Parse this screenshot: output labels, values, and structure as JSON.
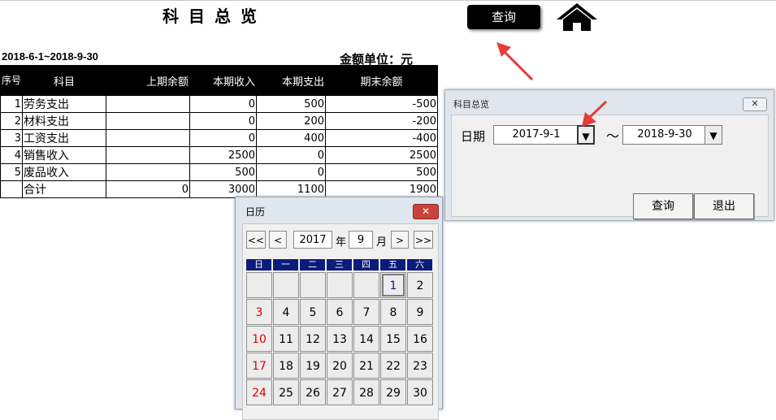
{
  "header": {
    "title": "科目总览",
    "query_label": "查询",
    "date_range": "2018-6-1~2018-9-30",
    "unit_label": "金额单位：元"
  },
  "table": {
    "columns": [
      "序号",
      "科目",
      "上期余额",
      "本期收入",
      "本期支出",
      "期末余额"
    ],
    "rows": [
      {
        "no": "1",
        "subject": "劳务支出",
        "prev": "",
        "income": "0",
        "expense": "500",
        "end": "-500"
      },
      {
        "no": "2",
        "subject": "材料支出",
        "prev": "",
        "income": "0",
        "expense": "200",
        "end": "-200"
      },
      {
        "no": "3",
        "subject": "工资支出",
        "prev": "",
        "income": "0",
        "expense": "400",
        "end": "-400"
      },
      {
        "no": "4",
        "subject": "销售收入",
        "prev": "",
        "income": "2500",
        "expense": "0",
        "end": "2500"
      },
      {
        "no": "5",
        "subject": "废品收入",
        "prev": "",
        "income": "500",
        "expense": "0",
        "end": "500"
      }
    ],
    "total": {
      "no": "",
      "subject": "合计",
      "prev": "0",
      "income": "3000",
      "expense": "1100",
      "end": "1900"
    }
  },
  "dialog": {
    "title": "科目总览",
    "close": "✕",
    "date_label": "日期",
    "start_date": "2017-9-1",
    "end_date": "2018-9-30",
    "dropdown": "▼",
    "tilde": "～",
    "query_label": "查询",
    "exit_label": "退出"
  },
  "calendar": {
    "title": "日历",
    "close": "✕",
    "prev_year": "<<",
    "prev_month": "<",
    "next_month": ">",
    "next_year": ">>",
    "year": "2017",
    "year_label": "年",
    "month": "9",
    "month_label": "月",
    "weekdays": [
      "日",
      "一",
      "二",
      "三",
      "四",
      "五",
      "六"
    ],
    "selected_day": "1",
    "days": [
      "",
      "",
      "",
      "",
      "",
      "1",
      "2",
      "3",
      "4",
      "5",
      "6",
      "7",
      "8",
      "9",
      "10",
      "11",
      "12",
      "13",
      "14",
      "15",
      "16",
      "17",
      "18",
      "19",
      "20",
      "21",
      "22",
      "23",
      "24",
      "25",
      "26",
      "27",
      "28",
      "29",
      "30"
    ]
  },
  "colors": {
    "arrow": "#e83a3a",
    "weekday_header": "#0b1c7a",
    "sunday": "#e00000"
  },
  "icons": {
    "home": "home-icon",
    "arrow": "red-arrow-icon"
  }
}
